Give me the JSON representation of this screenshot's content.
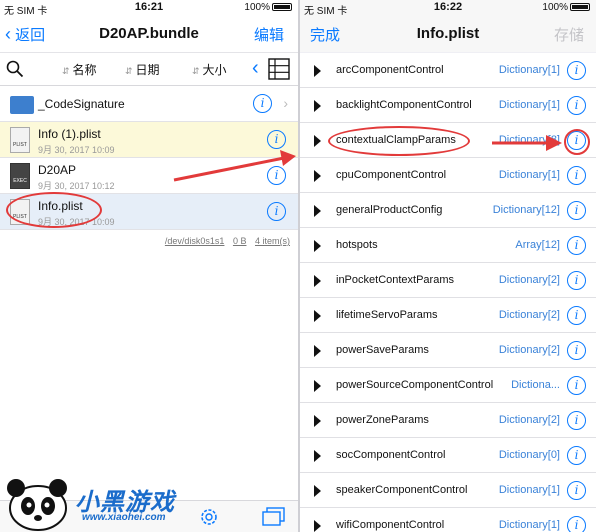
{
  "left": {
    "status": {
      "carrier": "无 SIM 卡",
      "time": "16:21",
      "battery": "100%"
    },
    "nav": {
      "back_label": "返回",
      "title": "D20AP.bundle",
      "edit_label": "编辑"
    },
    "sort": [
      {
        "label": "名称"
      },
      {
        "label": "日期"
      },
      {
        "label": "大小"
      }
    ],
    "files": [
      {
        "name": "_CodeSignature",
        "date": "",
        "icon": "folder-icon"
      },
      {
        "name": "Info (1).plist",
        "date": "9月 30, 2017 10:09",
        "icon": "plist-file-icon",
        "badge": "PLIST"
      },
      {
        "name": "D20AP",
        "date": "9月 30, 2017 10:12",
        "icon": "exec-file-icon",
        "badge": "EXEC"
      },
      {
        "name": "Info.plist",
        "date": "9月 30, 2017 10:09",
        "icon": "plist-file-icon",
        "badge": "PLIST"
      }
    ],
    "path": {
      "dir": "/dev/disk0s1s1",
      "size": "0 B",
      "count": "4 item(s)"
    }
  },
  "right": {
    "status": {
      "carrier": "无 SIM 卡",
      "time": "16:22",
      "battery": "100%"
    },
    "nav": {
      "done_label": "完成",
      "title": "Info.plist",
      "save_label": "存储"
    },
    "rows": [
      {
        "key": "arcComponentControl",
        "type": "Dictionary[1]"
      },
      {
        "key": "backlightComponentControl",
        "type": "Dictionary[1]"
      },
      {
        "key": "contextualClampParams",
        "type": "Dictionary[8]"
      },
      {
        "key": "cpuComponentControl",
        "type": "Dictionary[1]"
      },
      {
        "key": "generalProductConfig",
        "type": "Dictionary[12]"
      },
      {
        "key": "hotspots",
        "type": "Array[12]"
      },
      {
        "key": "inPocketContextParams",
        "type": "Dictionary[2]"
      },
      {
        "key": "lifetimeServoParams",
        "type": "Dictionary[2]"
      },
      {
        "key": "powerSaveParams",
        "type": "Dictionary[2]"
      },
      {
        "key": "powerSourceComponentControl",
        "type": "Dictiona..."
      },
      {
        "key": "powerZoneParams",
        "type": "Dictionary[2]"
      },
      {
        "key": "socComponentControl",
        "type": "Dictionary[0]"
      },
      {
        "key": "speakerComponentControl",
        "type": "Dictionary[1]"
      },
      {
        "key": "wifiComponentControl",
        "type": "Dictionary[1]"
      }
    ]
  },
  "watermark": {
    "text": "小黑游戏",
    "url": "www.xiaohei.com"
  },
  "colors": {
    "accent": "#0a7aff",
    "annotation": "#e23a3a",
    "type_text": "#3a82d8"
  }
}
